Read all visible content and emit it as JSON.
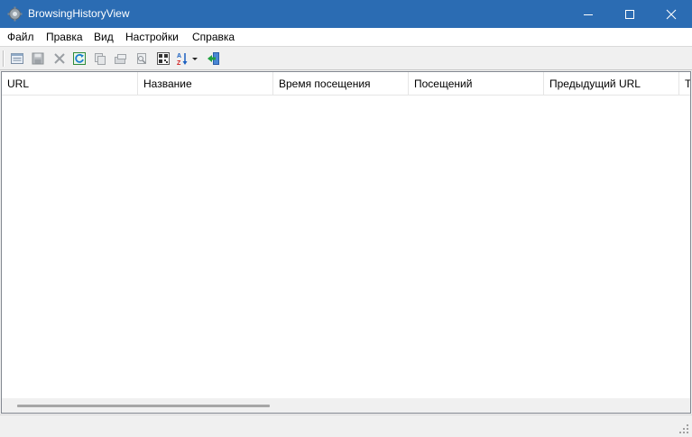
{
  "window": {
    "title": "BrowsingHistoryView",
    "icon": "gear-icon",
    "controls": [
      "minimize-icon",
      "maximize-icon",
      "close-icon"
    ],
    "titlebar_color": "#2b6cb3"
  },
  "menu": {
    "items": [
      "Файл",
      "Правка",
      "Вид",
      "Настройки",
      "Справка"
    ]
  },
  "toolbar": {
    "buttons": [
      "properties-icon",
      "save-icon",
      "delete-icon",
      "refresh-icon",
      "copy-icon",
      "export-icon",
      "find-icon",
      "html-report-icon",
      "sort-icon",
      "exit-icon"
    ]
  },
  "table": {
    "columns": [
      "URL",
      "Название",
      "Время посещения",
      "Посещений",
      "Предыдущий URL",
      "Т"
    ],
    "rows": []
  },
  "status": {
    "text": ""
  }
}
